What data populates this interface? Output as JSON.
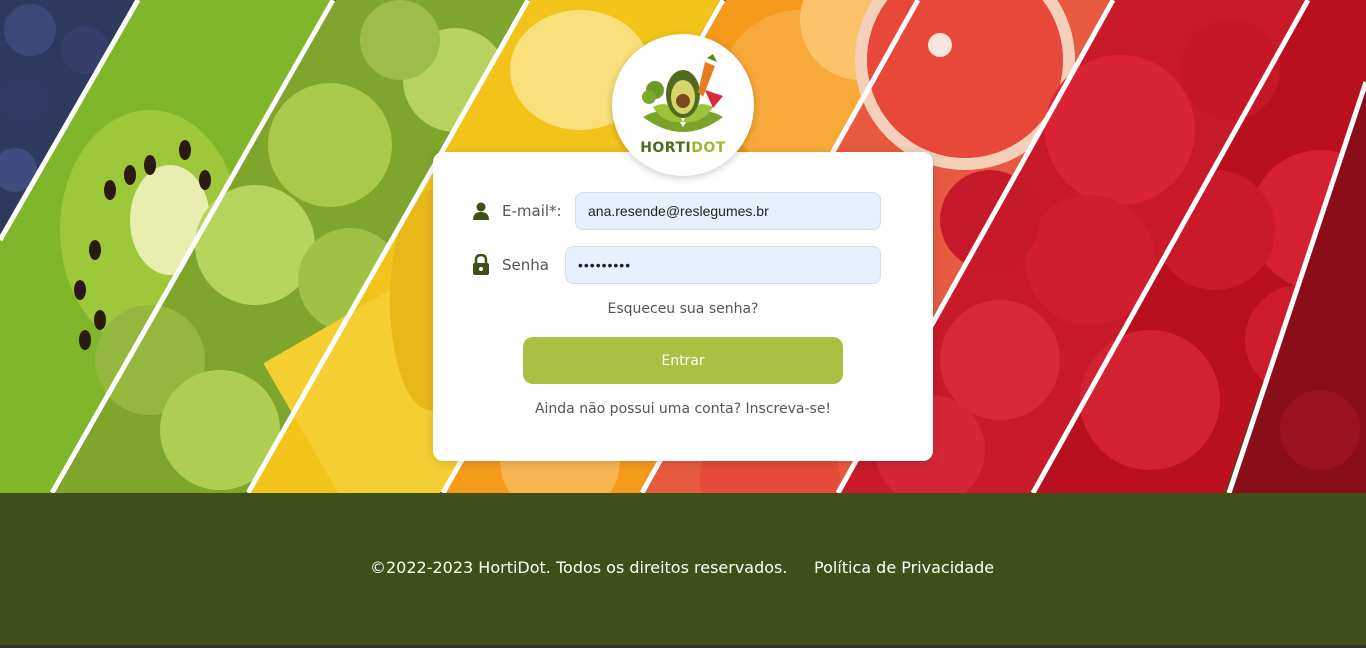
{
  "brand": {
    "name_part1": "HORTI",
    "name_part2": "DOT"
  },
  "login": {
    "email_label": "E-mail*:",
    "email_value": "ana.resende@reslegumes.br",
    "password_label": "Senha",
    "password_value": "•••••••••",
    "forgot_link": "Esqueceu sua senha?",
    "submit_label": "Entrar",
    "signup_link": "Ainda não possui uma conta? Inscreva-se!"
  },
  "footer": {
    "copyright": "©2022-2023 HortiDot. Todos os direitos reservados.",
    "privacy_link": "Política de Privacidade"
  },
  "icons": {
    "email": "user-icon",
    "password": "lock-icon"
  },
  "colors": {
    "brand_dark": "#3e5018",
    "brand_light": "#a9c043",
    "input_bg": "#e8f0fe"
  }
}
